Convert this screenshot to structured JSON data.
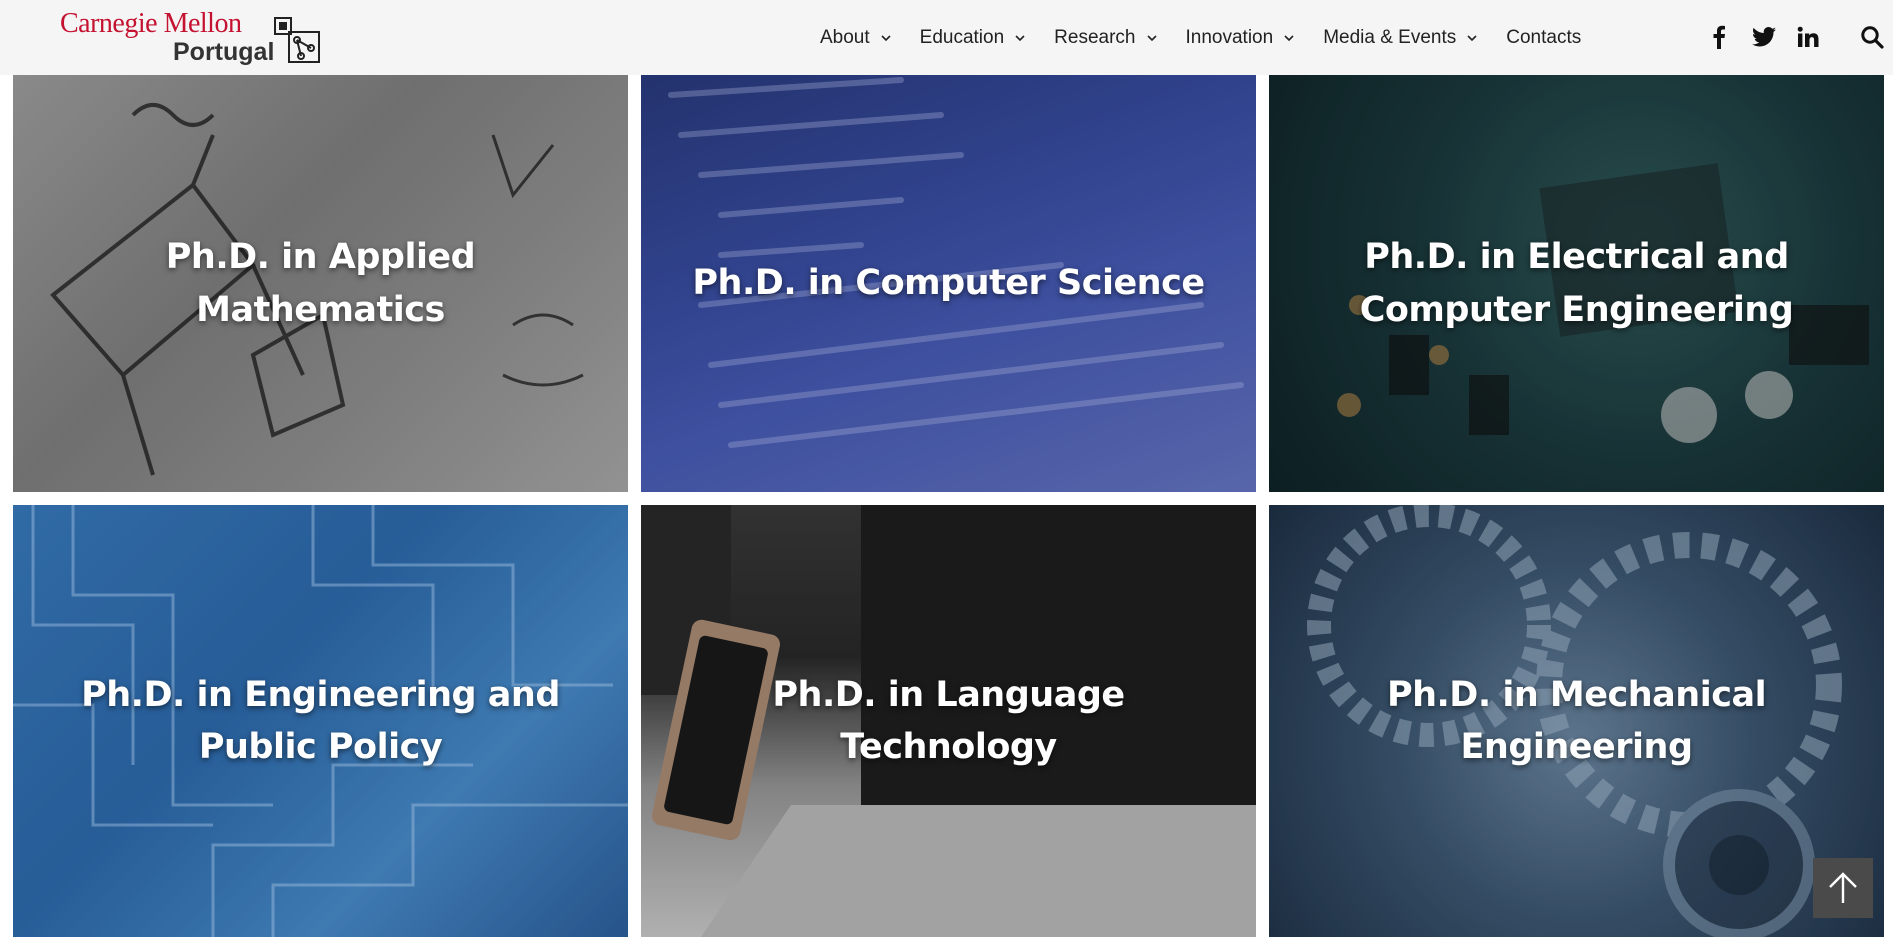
{
  "header": {
    "logo": {
      "line1": "Carnegie Mellon",
      "line2": "Portugal",
      "brand_color": "#c41230"
    },
    "nav": [
      {
        "label": "About",
        "has_dropdown": true
      },
      {
        "label": "Education",
        "has_dropdown": true
      },
      {
        "label": "Research",
        "has_dropdown": true
      },
      {
        "label": "Innovation",
        "has_dropdown": true
      },
      {
        "label": "Media & Events",
        "has_dropdown": true
      },
      {
        "label": "Contacts",
        "has_dropdown": false
      }
    ],
    "social_icons": [
      "facebook-icon",
      "twitter-icon",
      "linkedin-icon"
    ],
    "search_icon": "search-icon"
  },
  "programs": [
    {
      "label": "Ph.D. in Applied Mathematics"
    },
    {
      "label": "Ph.D. in Computer Science"
    },
    {
      "label": "Ph.D. in Electrical and Computer Engineering"
    },
    {
      "label": "Ph.D. in Engineering and Public Policy"
    },
    {
      "label": "Ph.D. in Language Technology"
    },
    {
      "label": "Ph.D. in Mechanical Engineering"
    }
  ],
  "back_to_top": {
    "icon": "arrow-up-icon"
  }
}
